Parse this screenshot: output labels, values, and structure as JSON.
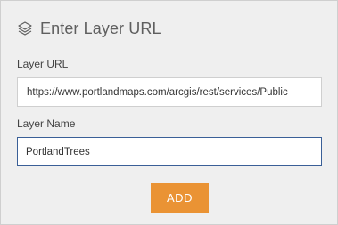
{
  "header": {
    "title": "Enter Layer URL",
    "icon": "layers-icon"
  },
  "form": {
    "url_label": "Layer URL",
    "url_value": "https://www.portlandmaps.com/arcgis/rest/services/Public",
    "name_label": "Layer Name",
    "name_value": "PortlandTrees",
    "add_label": "ADD"
  },
  "colors": {
    "accent_button": "#ea9334",
    "focus_border": "#3a5f97",
    "panel_bg": "#efefef"
  }
}
